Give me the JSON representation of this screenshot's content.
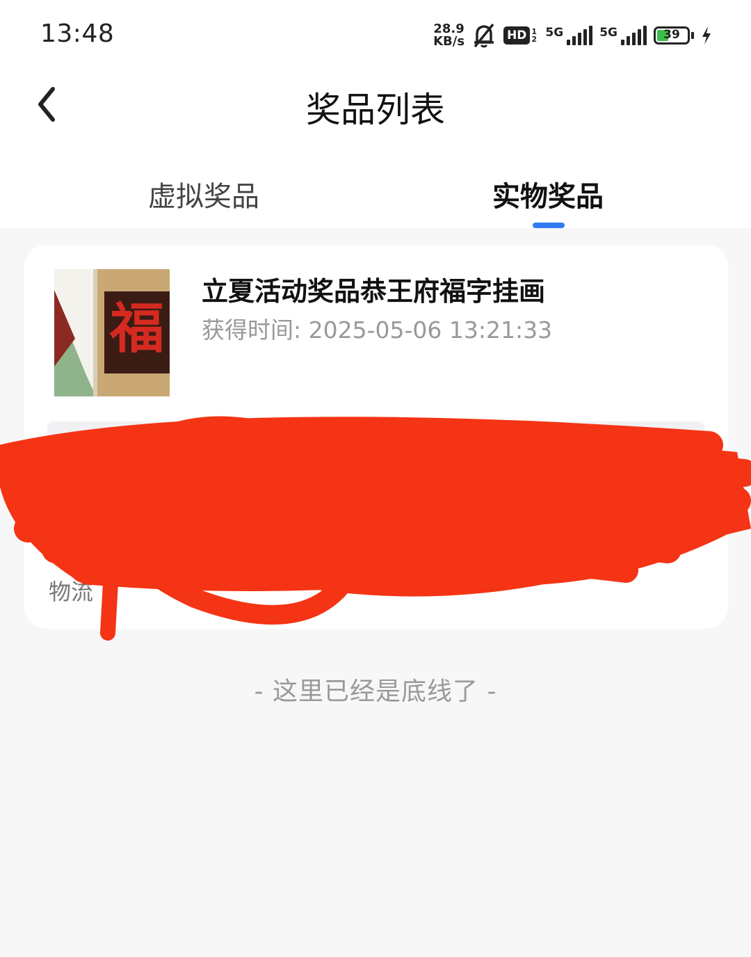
{
  "status_bar": {
    "time": "13:48",
    "net_speed_value": "28.9",
    "net_speed_unit": "KB/s",
    "hd_badge": "HD",
    "hd_sub": "1 2",
    "sim1_label": "5G",
    "sim2_label": "5G",
    "battery_level": "39",
    "battery_fill_percent": 39
  },
  "header": {
    "title": "奖品列表"
  },
  "tabs": [
    {
      "label": "虚拟奖品",
      "active": false
    },
    {
      "label": "实物奖品",
      "active": true
    }
  ],
  "prize": {
    "name": "立夏活动奖品恭王府福字挂画",
    "obtained_label": "获得时间:",
    "obtained_time": "2025-05-06 13:21:33",
    "image_glyph": "福",
    "logistics_label": "物流"
  },
  "footer": {
    "text": "- 这里已经是底线了 -"
  },
  "colors": {
    "accent": "#2f7bf2",
    "redaction": "#f43414",
    "battery_green": "#3fbf4a"
  }
}
